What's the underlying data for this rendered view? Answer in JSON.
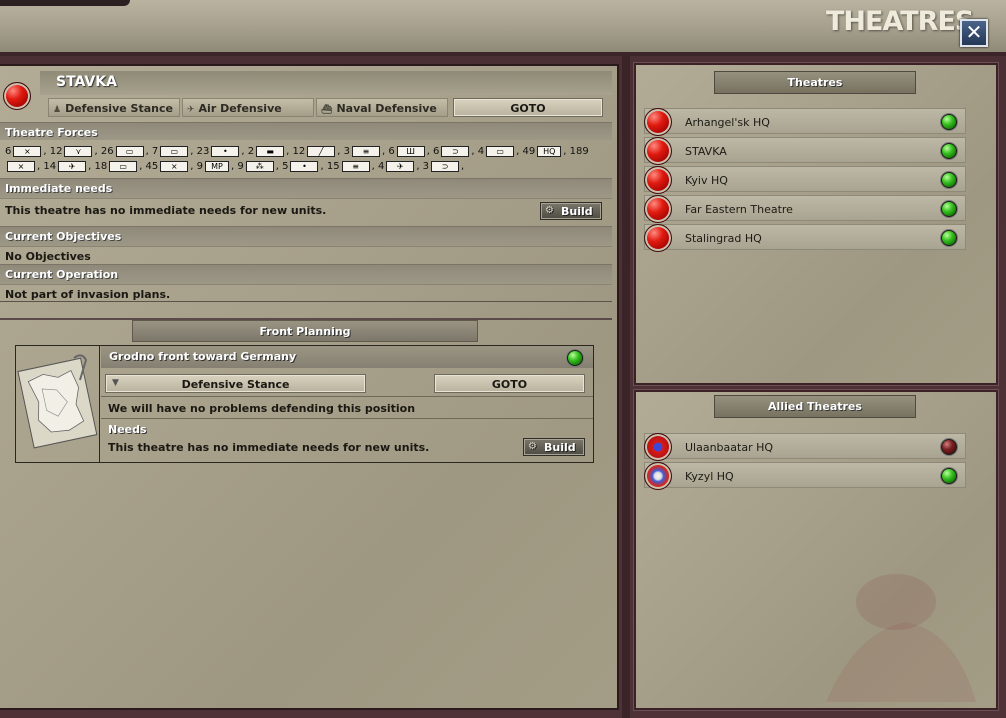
{
  "window": {
    "title": "THEATRES",
    "close_icon": "close-icon"
  },
  "theatre": {
    "name": "STAVKA",
    "stance_buttons": [
      {
        "label": "Defensive Stance",
        "icon": "infantry-icon"
      },
      {
        "label": "Air Defensive",
        "icon": "plane-icon"
      },
      {
        "label": "Naval Defensive",
        "icon": "ship-icon"
      }
    ],
    "goto_label": "GOTO",
    "sections": {
      "forces_header": "Theatre Forces",
      "needs_header": "Immediate needs",
      "needs_text": "This theatre has no immediate needs for new units.",
      "objectives_header": "Current Objectives",
      "objectives_text": "No Objectives",
      "operation_header": "Current Operation",
      "operation_text": "Not part of invasion plans."
    },
    "build_label": "Build",
    "forces": [
      {
        "count": "6",
        "sym": "⨯"
      },
      {
        "count": "12",
        "sym": "⋎"
      },
      {
        "count": "26",
        "sym": "▭"
      },
      {
        "count": "7",
        "sym": "▭"
      },
      {
        "count": "23",
        "sym": "•"
      },
      {
        "count": "2",
        "sym": "▬"
      },
      {
        "count": "12",
        "sym": "╱"
      },
      {
        "count": "3",
        "sym": "≡"
      },
      {
        "count": "6",
        "sym": "Ш"
      },
      {
        "count": "6",
        "sym": "⊃"
      },
      {
        "count": "4",
        "sym": "▭"
      },
      {
        "count": "49",
        "sym": "HQ"
      },
      {
        "count": "189",
        "sym": "⨯"
      },
      {
        "count": "14",
        "sym": "✈"
      },
      {
        "count": "18",
        "sym": "▭"
      },
      {
        "count": "45",
        "sym": "⨯"
      },
      {
        "count": "9",
        "sym": "MP"
      },
      {
        "count": "9",
        "sym": "⁂"
      },
      {
        "count": "5",
        "sym": "•"
      },
      {
        "count": "15",
        "sym": "≡"
      },
      {
        "count": "4",
        "sym": "✈"
      },
      {
        "count": "3",
        "sym": "⊃"
      }
    ]
  },
  "front_planning": {
    "title": "Front Planning",
    "front": {
      "name": "Grodno front toward Germany",
      "stance": "Defensive Stance",
      "goto_label": "GOTO",
      "assessment": "We will have no problems defending this position",
      "needs_header": "Needs",
      "needs_text": "This theatre has no immediate needs for new units.",
      "build_label": "Build",
      "status": "green"
    }
  },
  "theatres_list": {
    "title": "Theatres",
    "items": [
      {
        "name": "Arhangel'sk HQ",
        "status": "green"
      },
      {
        "name": "STAVKA",
        "status": "green"
      },
      {
        "name": "Kyiv HQ",
        "status": "green"
      },
      {
        "name": "Far Eastern Theatre",
        "status": "green"
      },
      {
        "name": "Stalingrad HQ",
        "status": "green"
      }
    ]
  },
  "allied_list": {
    "title": "Allied Theatres",
    "items": [
      {
        "name": "Ulaanbaatar HQ",
        "status": "red",
        "flag": "mongolia-flag"
      },
      {
        "name": "Kyzyl HQ",
        "status": "green",
        "flag": "tannu-tuva-flag"
      }
    ]
  },
  "colors": {
    "accent_red": "#e01a10",
    "status_green": "#36c020",
    "panel_bg": "#a7a08a",
    "frame": "#4a3035"
  }
}
